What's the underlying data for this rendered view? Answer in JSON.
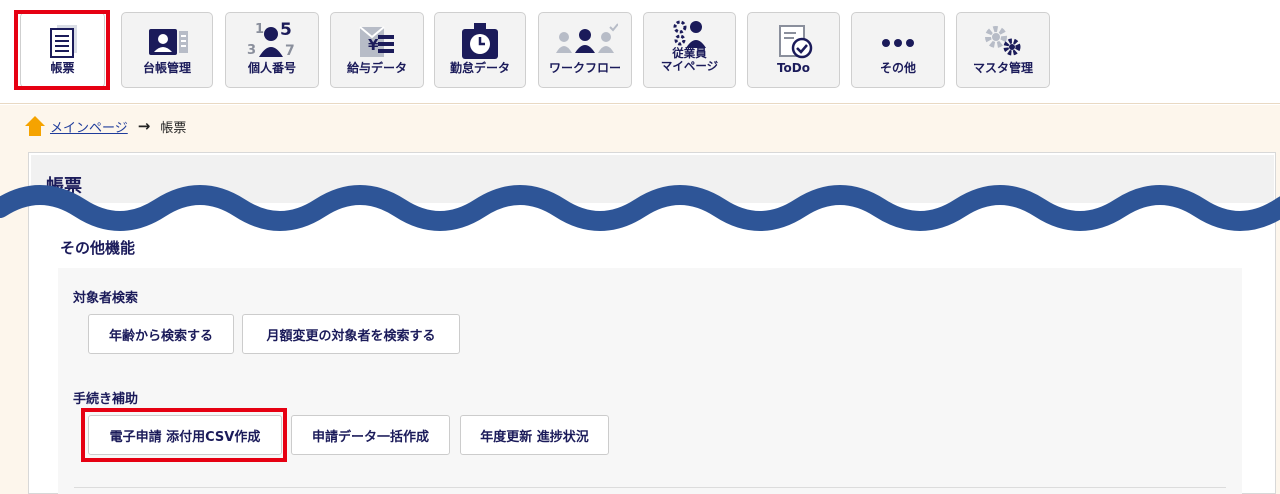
{
  "nav": {
    "items": [
      {
        "label": "帳票",
        "icon": "document-list-icon"
      },
      {
        "label": "台帳管理",
        "icon": "id-card-icon"
      },
      {
        "label": "個人番号",
        "icon": "person-number-icon"
      },
      {
        "label": "給与データ",
        "icon": "yen-document-icon"
      },
      {
        "label": "勤怠データ",
        "icon": "clock-folder-icon"
      },
      {
        "label": "ワークフロー",
        "icon": "people-flow-icon"
      },
      {
        "label1": "従業員",
        "label2": "マイページ",
        "icon": "employee-gear-icon"
      },
      {
        "label": "ToDo",
        "icon": "todo-check-icon"
      },
      {
        "label": "その他",
        "icon": "more-dots-icon"
      },
      {
        "label": "マスタ管理",
        "icon": "gears-icon"
      }
    ],
    "number_glyphs": {
      "n1": "1",
      "n3": "3",
      "n5": "5",
      "n7": "7"
    },
    "yen_glyph": "¥"
  },
  "breadcrumb": {
    "home": "メインページ",
    "current": "帳票"
  },
  "page": {
    "title": "帳票"
  },
  "section": {
    "title": "その他機能",
    "groups": [
      {
        "label": "対象者検索",
        "buttons": [
          "年齢から検索する",
          "月額変更の対象者を検索する"
        ]
      },
      {
        "label": "手続き補助",
        "buttons": [
          "電子申請 添付用CSV作成",
          "申請データ一括作成",
          "年度更新 進捗状況"
        ]
      }
    ]
  },
  "colors": {
    "highlight": "#e60012",
    "wave": "#2e5597",
    "navy": "#1b1b5a",
    "page_bg": "#fdf6ec",
    "home_icon": "#f5a300"
  }
}
